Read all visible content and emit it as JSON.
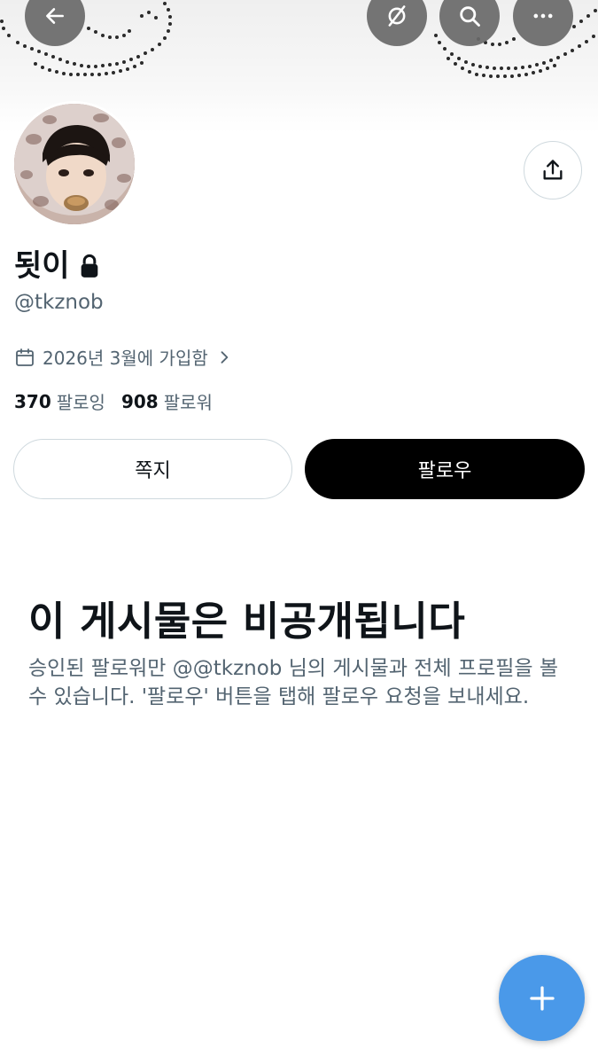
{
  "header": {
    "back_icon": "arrow-left-icon",
    "secondary_icon": "grok-slash-icon",
    "search_icon": "search-icon",
    "more_icon": "ellipsis-icon"
  },
  "profile": {
    "display_name": "됫이",
    "locked_icon": "lock-icon",
    "handle": "@tkznob",
    "joined": "2026년 3월에 가입함",
    "following_count": "370",
    "following_label": "팔로잉",
    "followers_count": "908",
    "followers_label": "팔로워",
    "share_icon": "share-icon"
  },
  "actions": {
    "message_label": "쪽지",
    "follow_label": "팔로우"
  },
  "private_notice": {
    "title": "이 게시물은 비공개됩니다",
    "description": "승인된 팔로워만 @@tkznob 님의 게시물과 전체 프로필을 볼 수 있습니다. '팔로우' 버튼을 탭해 팔로우 요청을 보내세요."
  },
  "fab": {
    "icon": "plus-icon"
  },
  "colors": {
    "accent": "#4a99e9",
    "text_primary": "#0f1419",
    "text_secondary": "#536471",
    "border": "#cfd9de",
    "follow_bg": "#000000"
  }
}
